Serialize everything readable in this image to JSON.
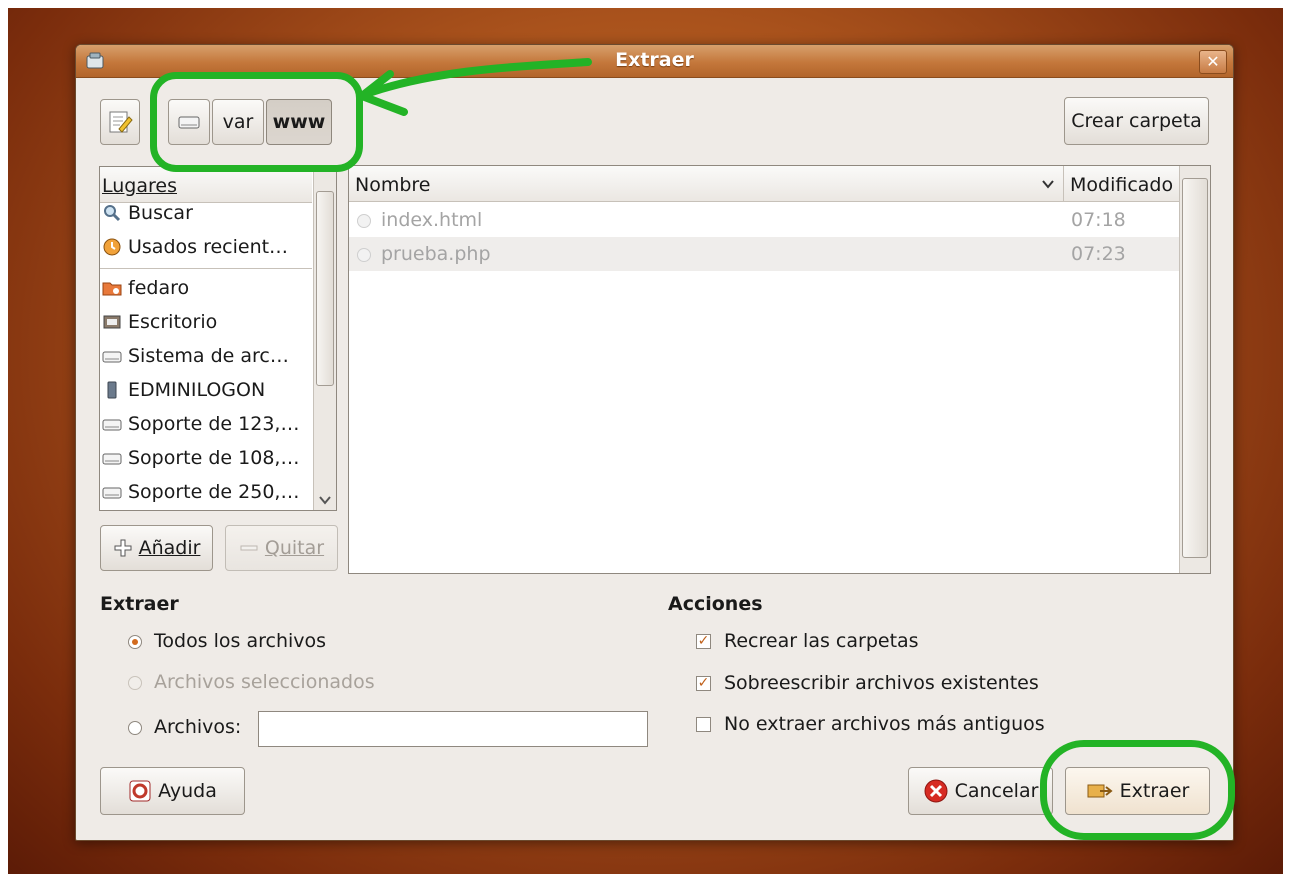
{
  "dialog": {
    "title": "Extraer",
    "close_symbol": "✕"
  },
  "path_bar": {
    "segments": [
      "var",
      "www"
    ],
    "create_folder_label": "Crear carpeta"
  },
  "places": {
    "header": "Lugares",
    "items": [
      {
        "label": "Buscar",
        "icon": "search-icon"
      },
      {
        "label": "Usados recient…",
        "icon": "recent-icon"
      },
      {
        "label": "fedaro",
        "icon": "home-folder-icon"
      },
      {
        "label": "Escritorio",
        "icon": "desktop-icon"
      },
      {
        "label": "Sistema de arc…",
        "icon": "drive-icon"
      },
      {
        "label": "EDMINILOGON",
        "icon": "usb-drive-icon"
      },
      {
        "label": "Soporte de 123,…",
        "icon": "drive-icon"
      },
      {
        "label": "Soporte de 108,…",
        "icon": "drive-icon"
      },
      {
        "label": "Soporte de 250,…",
        "icon": "drive-icon"
      }
    ],
    "add_label": "Añadir",
    "remove_label": "Quitar"
  },
  "files": {
    "columns": [
      "Nombre",
      "Modificado"
    ],
    "rows": [
      {
        "name": "index.html",
        "modified": "07:18"
      },
      {
        "name": "prueba.php",
        "modified": "07:23"
      }
    ]
  },
  "extract_section": {
    "title": "Extraer",
    "options": [
      "Todos los archivos",
      "Archivos seleccionados",
      "Archivos:"
    ],
    "selected": "Todos los archivos",
    "files_field_value": ""
  },
  "actions_section": {
    "title": "Acciones",
    "options": [
      {
        "label": "Recrear las carpetas",
        "checked": true
      },
      {
        "label": "Sobreescribir archivos existentes",
        "checked": true
      },
      {
        "label": "No extraer archivos más antiguos",
        "checked": false
      }
    ]
  },
  "buttons": {
    "help": "Ayuda",
    "cancel": "Cancelar",
    "extract": "Extraer"
  },
  "colors": {
    "accent_orange": "#c4773b",
    "highlight_green": "#23b326"
  }
}
